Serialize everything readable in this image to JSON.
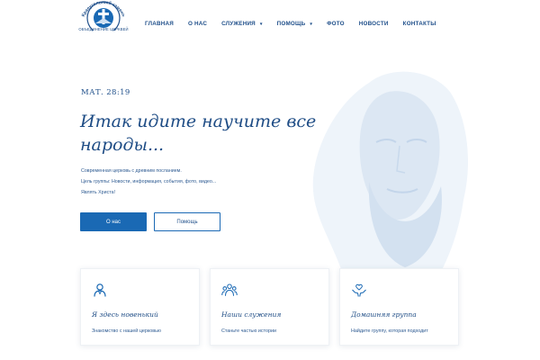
{
  "header": {
    "logo": {
      "arc_text": "Краеугольный камень",
      "caption": "ОБЪЕДИНЕНИЕ ЦЕРКВЕЙ"
    },
    "nav": [
      {
        "label": "ГЛАВНАЯ"
      },
      {
        "label": "О НАС"
      },
      {
        "label": "СЛУЖЕНИЯ",
        "icon": "chevron-down-icon"
      },
      {
        "label": "ПОМОЩЬ",
        "icon": "chevron-down-icon"
      },
      {
        "label": "ФОТО"
      },
      {
        "label": "НОВОСТИ"
      },
      {
        "label": "КОНТАКТЫ"
      }
    ]
  },
  "hero": {
    "verse": "МАТ. 28:19",
    "title": "Итак идите научите все народы...",
    "lines": [
      "Современная церковь с древним посланием.",
      "Цель группы: Новости, информация, события, фото, видео...",
      "Являть Христа!"
    ],
    "primary_button": "О нас",
    "secondary_button": "Помощь"
  },
  "cards": [
    {
      "title": "Я здесь новенький",
      "text": "Знакомство с нашей церковью",
      "icon": "newcomer-person-icon"
    },
    {
      "title": "Наши служения",
      "text": "Станьте частью истории",
      "icon": "group-people-icon"
    },
    {
      "title": "Домашняя группа",
      "text": "Найдите группу, которая подходит",
      "icon": "hands-heart-icon"
    }
  ],
  "colors": {
    "brand": "#1f4f8a",
    "accent": "#1a69b4",
    "background": "#ffffff",
    "watermark": "#dce7f3"
  }
}
